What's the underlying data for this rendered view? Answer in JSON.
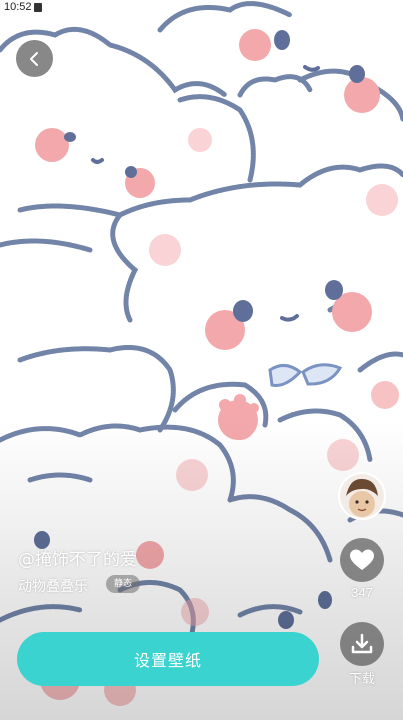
{
  "status_bar": {
    "time": "10:52"
  },
  "wallpaper": {
    "bg_color": "#ffffff",
    "outline_color": "#7284a8",
    "blush_color": "#f3a8ab"
  },
  "post": {
    "author": "@掩饰不了的爱",
    "album": "动物叠叠乐",
    "badge": "静态"
  },
  "actions": {
    "like_count": "347",
    "download_label": "下载"
  },
  "primary_button": {
    "label": "设置壁纸",
    "color": "#3ad3cf"
  },
  "icons": {
    "back": "chevron-left-icon",
    "like": "heart-icon",
    "download": "download-icon"
  }
}
